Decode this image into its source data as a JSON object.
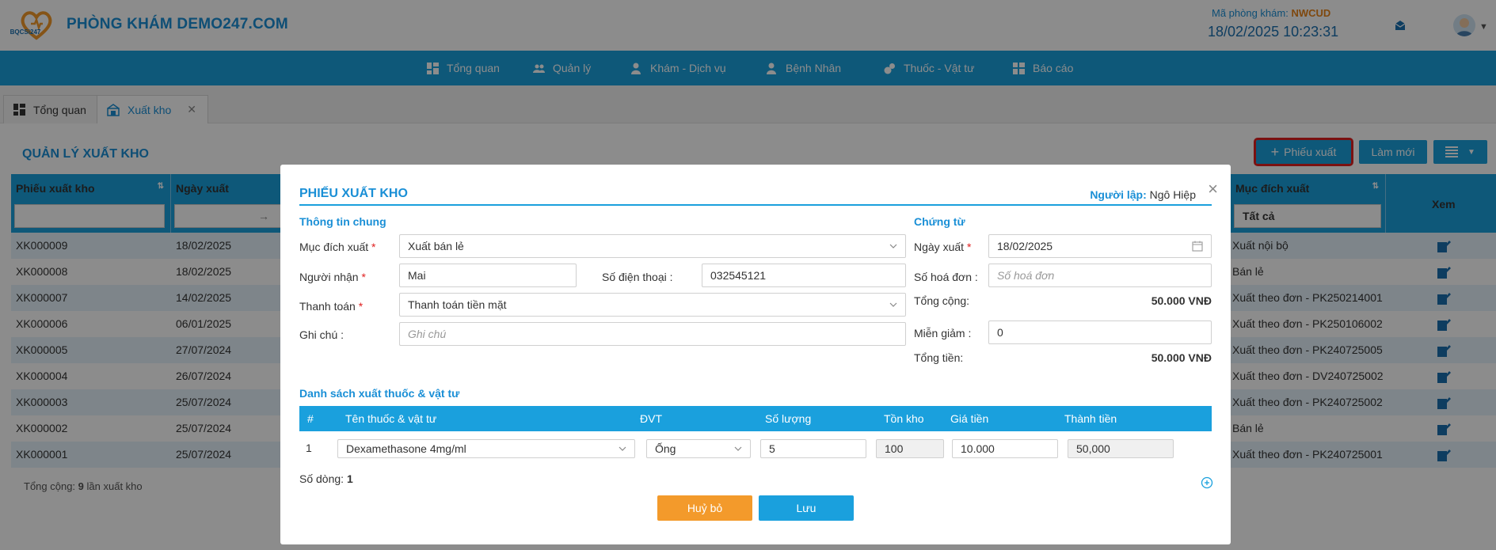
{
  "header": {
    "clinic_name": "PHÒNG KHÁM DEMO247.COM",
    "logo_text": "BQCSi247",
    "clinic_code_label": "Mã phòng khám:",
    "clinic_code": "NWCUD",
    "datetime": "18/02/2025 10:23:31"
  },
  "nav": {
    "items": [
      {
        "label": "Tổng quan",
        "icon": "dashboard-icon"
      },
      {
        "label": "Quản lý",
        "icon": "users-icon"
      },
      {
        "label": "Khám - Dịch vụ",
        "icon": "doctor-icon"
      },
      {
        "label": "Bệnh Nhân",
        "icon": "patient-icon"
      },
      {
        "label": "Thuốc - Vật tư",
        "icon": "pills-icon"
      },
      {
        "label": "Báo cáo",
        "icon": "report-icon"
      }
    ]
  },
  "tabs": [
    {
      "label": "Tổng quan"
    },
    {
      "label": "Xuất kho"
    }
  ],
  "page": {
    "title": "QUẢN LÝ XUẤT KHO",
    "add_button": "Phiếu xuất",
    "refresh_button": "Làm mới",
    "total_prefix": "Tổng cộng:",
    "total_count": "9",
    "total_suffix": "lần xuất kho"
  },
  "grid": {
    "columns": {
      "code": "Phiếu xuất kho",
      "date": "Ngày xuất",
      "purpose": "Mục đích xuất",
      "view": "Xem"
    },
    "purpose_filter": "Tất cả",
    "date_filter_arrow": "→",
    "rows": [
      {
        "code": "XK000009",
        "date": "18/02/2025",
        "purpose": "Xuất nội bộ"
      },
      {
        "code": "XK000008",
        "date": "18/02/2025",
        "purpose": "Bán lẻ"
      },
      {
        "code": "XK000007",
        "date": "14/02/2025",
        "purpose": "Xuất theo đơn - PK250214001"
      },
      {
        "code": "XK000006",
        "date": "06/01/2025",
        "purpose": "Xuất theo đơn - PK250106002"
      },
      {
        "code": "XK000005",
        "date": "27/07/2024",
        "purpose": "Xuất theo đơn - PK240725005"
      },
      {
        "code": "XK000004",
        "date": "26/07/2024",
        "purpose": "Xuất theo đơn - DV240725002"
      },
      {
        "code": "XK000003",
        "date": "25/07/2024",
        "purpose": "Xuất theo đơn - PK240725002"
      },
      {
        "code": "XK000002",
        "date": "25/07/2024",
        "purpose": "Bán lẻ"
      },
      {
        "code": "XK000001",
        "date": "25/07/2024",
        "purpose": "Xuất theo đơn - PK240725001"
      }
    ]
  },
  "modal": {
    "title": "PHIẾU XUẤT KHO",
    "creator_label": "Người lập:",
    "creator": "Ngô Hiệp",
    "general_section": "Thông tin chung",
    "voucher_section": "Chứng từ",
    "purpose_label": "Mục đích xuất",
    "purpose_value": "Xuất bán lẻ",
    "recipient_label": "Người nhận",
    "recipient_value": "Mai",
    "phone_label": "Số điện thoại",
    "phone_value": "032545121",
    "payment_label": "Thanh toán",
    "payment_value": "Thanh toán tiền mặt",
    "note_label": "Ghi chú",
    "note_placeholder": "Ghi chú",
    "date_label": "Ngày xuất",
    "date_value": "18/02/2025",
    "invoice_label": "Số hoá đơn",
    "invoice_placeholder": "Số hoá đơn",
    "subtotal_label": "Tổng cộng:",
    "subtotal_value": "50.000 VNĐ",
    "discount_label": "Miễn giảm",
    "discount_value": "0",
    "total_label": "Tổng tiền:",
    "total_value": "50.000 VNĐ",
    "list_section": "Danh sách xuất thuốc & vật tư",
    "table_headers": {
      "index": "#",
      "name": "Tên thuốc & vật tư",
      "unit": "ĐVT",
      "qty": "Số lượng",
      "stock": "Tồn kho",
      "price": "Giá tiền",
      "amount": "Thành tiền"
    },
    "items": [
      {
        "index": "1",
        "name": "Dexamethasone 4mg/ml",
        "unit": "Ống",
        "qty": "5",
        "stock": "100",
        "price": "10.000",
        "amount": "50,000"
      }
    ],
    "row_count_label": "Số dòng:",
    "row_count": "1",
    "cancel_button": "Huỷ bỏ",
    "save_button": "Lưu"
  },
  "colors": {
    "primary": "#1aa0dd",
    "accent": "#f39a2b",
    "highlight": "#e02020"
  }
}
